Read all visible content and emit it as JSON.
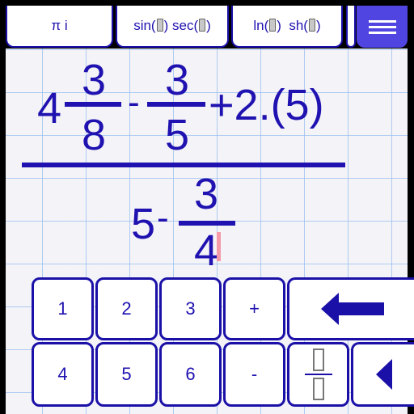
{
  "toolbar": {
    "tabs": [
      {
        "label": "π i"
      },
      {
        "label_parts": [
          "sin(",
          ") sec(",
          ")"
        ]
      },
      {
        "label_parts": [
          "ln(",
          ")  sh(",
          ")"
        ]
      }
    ],
    "menu_icon": "hamburger-menu-icon"
  },
  "expression": {
    "numerator": {
      "whole": "4",
      "frac1": {
        "num": "3",
        "den": "8"
      },
      "op1": "-",
      "frac2": {
        "num": "3",
        "den": "5"
      },
      "rest": "+2.(5)"
    },
    "denominator": {
      "whole": "5",
      "op": "-",
      "frac": {
        "num": "3",
        "den": "4"
      }
    }
  },
  "keypad": {
    "row1": [
      "1",
      "2",
      "3",
      "+"
    ],
    "row2": [
      "4",
      "5",
      "6",
      "-"
    ],
    "backspace_icon": "backspace-arrow-icon",
    "fraction_icon": "fraction-template-icon",
    "left_icon": "cursor-left-icon"
  },
  "colors": {
    "accent": "#1f12b0",
    "menu_button": "#5045e0",
    "cursor": "#f59aa8",
    "paper": "#f4f3f7",
    "grid": "#96bef0"
  }
}
